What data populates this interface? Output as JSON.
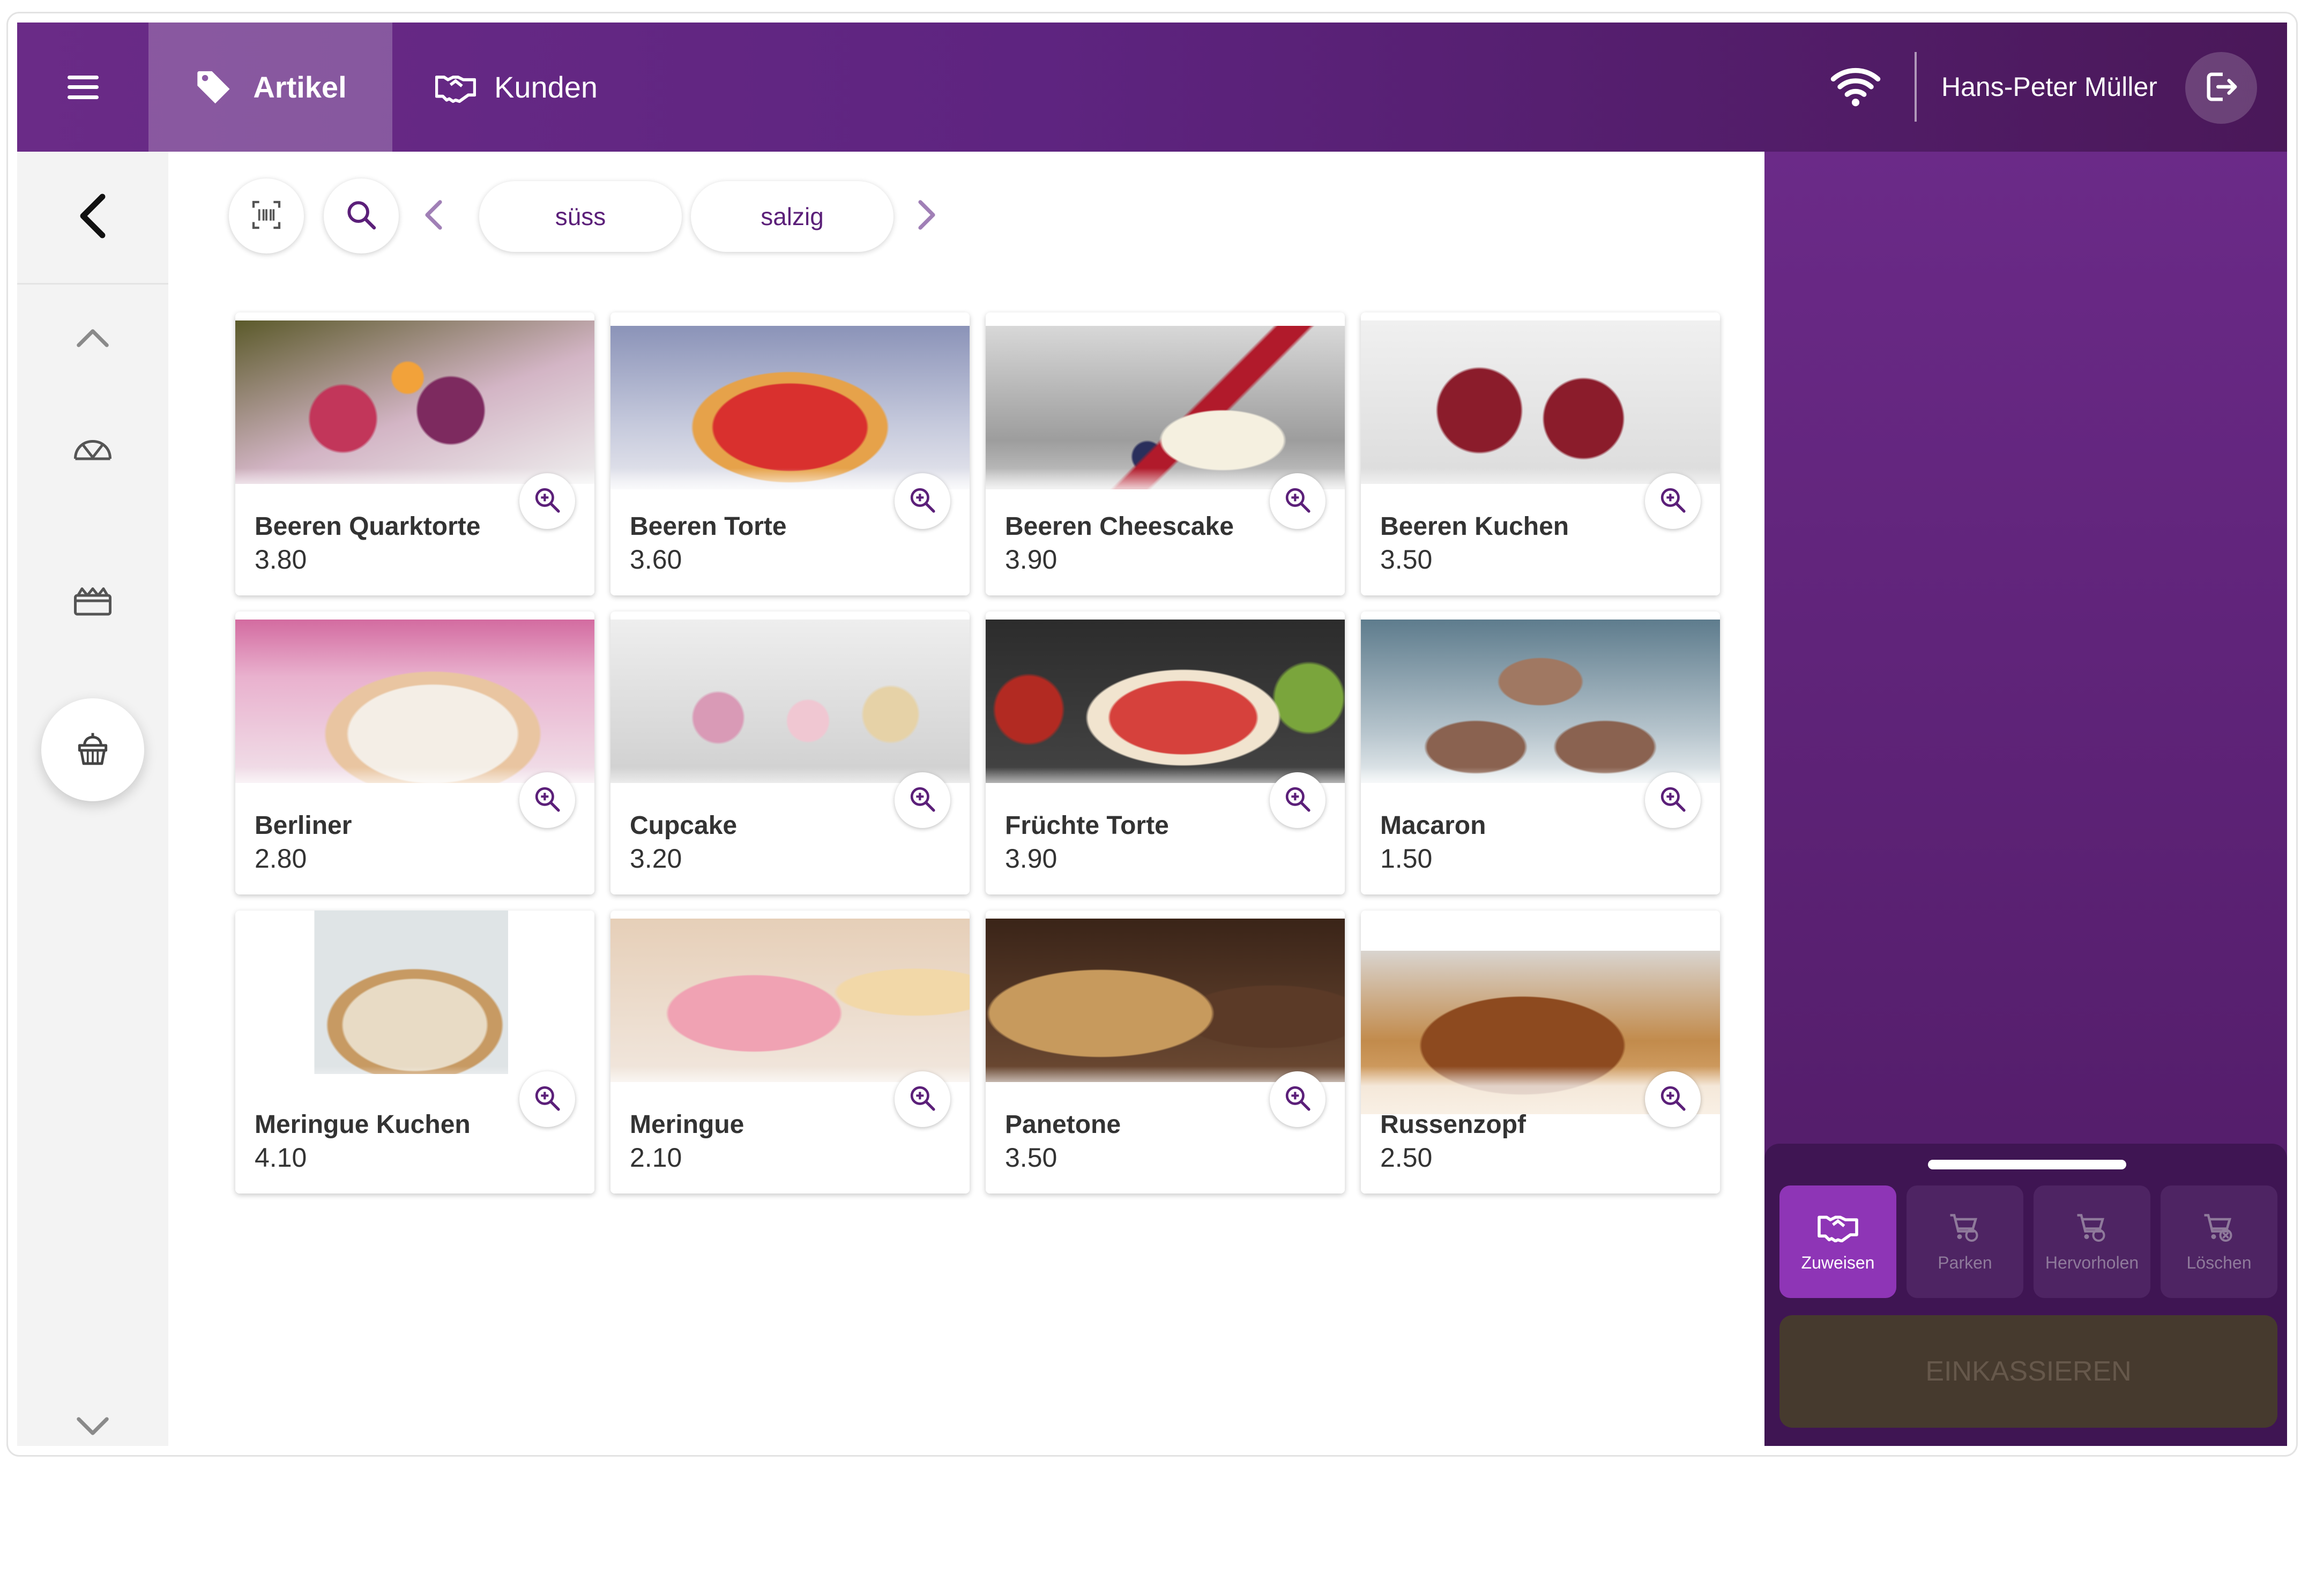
{
  "topbar": {
    "menu_icon": "hamburger-icon",
    "tabs": [
      {
        "label": "Artikel",
        "icon": "tag-icon",
        "active": true
      },
      {
        "label": "Kunden",
        "icon": "handshake-icon",
        "active": false
      }
    ],
    "wifi_icon": "wifi-icon",
    "user_name": "Hans-Peter Müller",
    "logout_icon": "logout-icon"
  },
  "sidebar": {
    "back_icon": "chevron-left-icon",
    "scroll_up_icon": "chevron-up-icon",
    "scroll_down_icon": "chevron-down-icon",
    "categories": [
      {
        "icon": "bread-icon",
        "active": false
      },
      {
        "icon": "box-icon",
        "active": false
      },
      {
        "icon": "cake-icon",
        "active": true
      }
    ]
  },
  "filters": {
    "barcode_icon": "barcode-scan-icon",
    "search_icon": "search-icon",
    "chips": [
      "süss",
      "salzig"
    ]
  },
  "products": [
    {
      "name": "Beeren Quarktorte",
      "price": "3.80"
    },
    {
      "name": "Beeren Torte",
      "price": "3.60"
    },
    {
      "name": "Beeren Cheescake",
      "price": "3.90"
    },
    {
      "name": "Beeren Kuchen",
      "price": "3.50"
    },
    {
      "name": "Berliner",
      "price": "2.80"
    },
    {
      "name": "Cupcake",
      "price": "3.20"
    },
    {
      "name": "Früchte Torte",
      "price": "3.90"
    },
    {
      "name": "Macaron",
      "price": "1.50"
    },
    {
      "name": "Meringue Kuchen",
      "price": "4.10"
    },
    {
      "name": "Meringue",
      "price": "2.10"
    },
    {
      "name": "Panetone",
      "price": "3.50"
    },
    {
      "name": "Russenzopf",
      "price": "2.50"
    }
  ],
  "cart": {
    "actions": [
      {
        "label": "Zuweisen",
        "icon": "handshake-icon",
        "active": true
      },
      {
        "label": "Parken",
        "icon": "cart-icon",
        "active": false
      },
      {
        "label": "Hervorholen",
        "icon": "cart-icon",
        "active": false
      },
      {
        "label": "Löschen",
        "icon": "cart-remove-icon",
        "active": false
      }
    ],
    "checkout_label": "EINKASSIEREN"
  },
  "colors": {
    "brand": "#5e2480",
    "accent": "#8e35b6",
    "panel": "#3f1553"
  }
}
